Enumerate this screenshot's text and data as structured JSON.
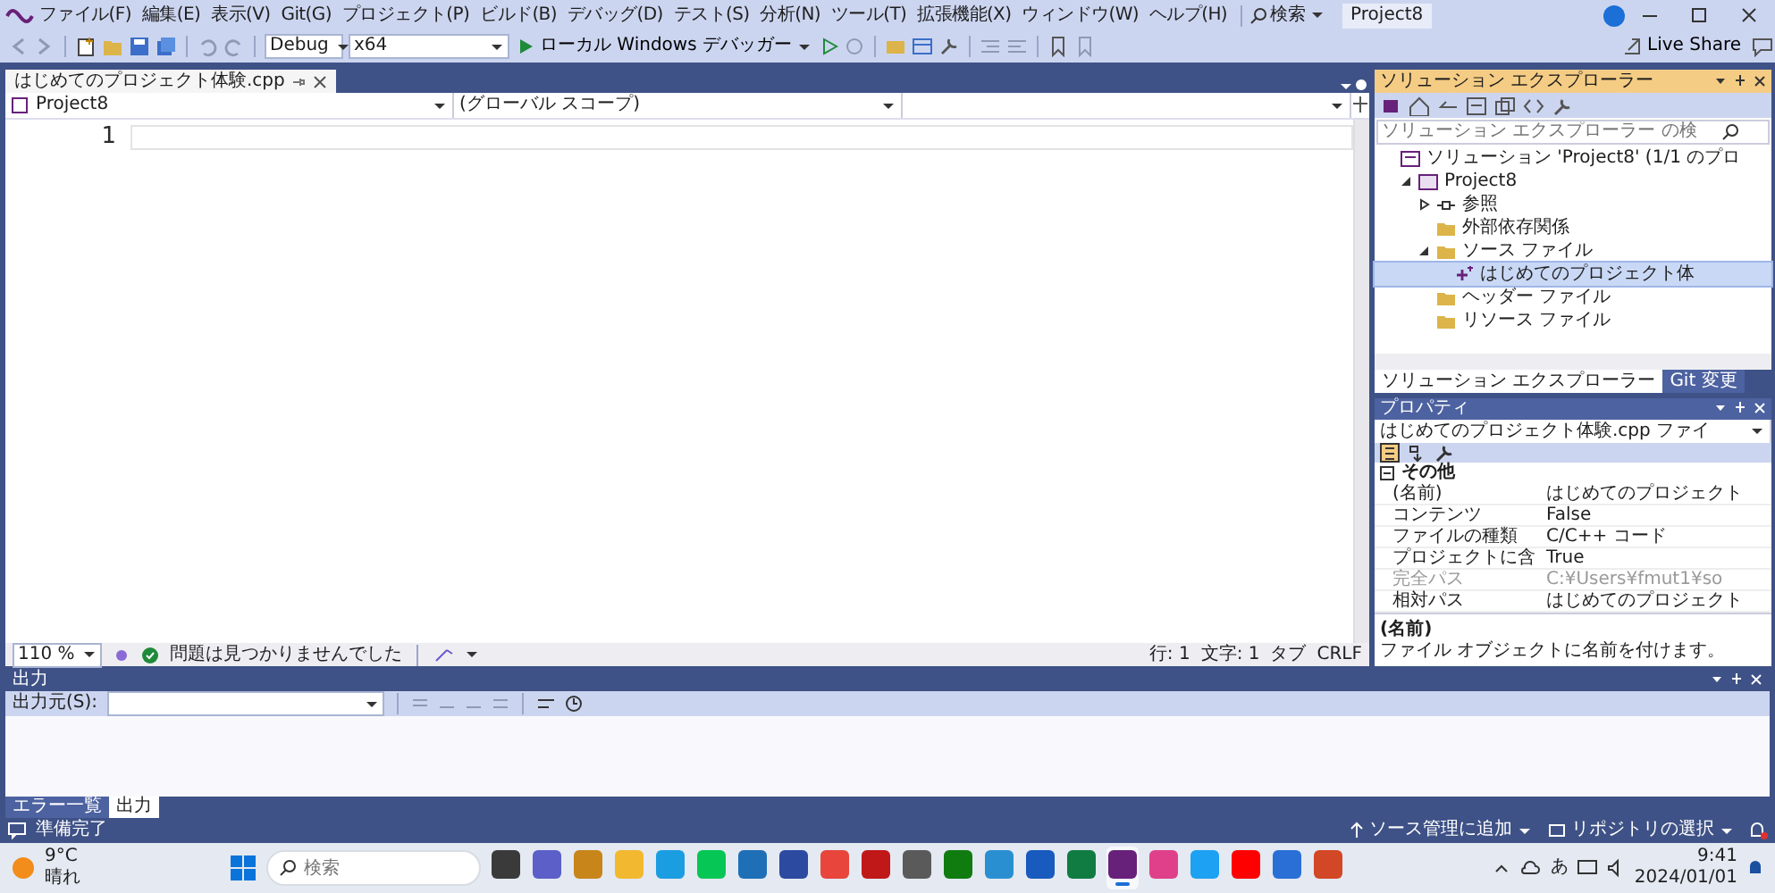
{
  "menu_bar": {
    "items": [
      "ファイル(F)",
      "編集(E)",
      "表示(V)",
      "Git(G)",
      "プロジェクト(P)",
      "ビルド(B)",
      "デバッグ(D)",
      "テスト(S)",
      "分析(N)",
      "ツール(T)",
      "拡張機能(X)",
      "ウィンドウ(W)",
      "ヘルプ(H)"
    ],
    "search": "検索",
    "solution_name": "Project8"
  },
  "toolbar": {
    "configuration": "Debug",
    "platform": "x64",
    "start_button": "ローカル Windows デバッガー",
    "live_share": "Live Share"
  },
  "document_tabs": [
    {
      "label": "はじめてのプロジェクト体験.cpp",
      "selected": true
    }
  ],
  "navigation_bar": {
    "project": "Project8",
    "scope": "(グローバル スコープ)"
  },
  "editor": {
    "line_numbers": [
      "1"
    ]
  },
  "editor_status": {
    "zoom": "110 %",
    "issues": "問題は見つかりませんでした",
    "line": "行: 1",
    "column": "文字: 1",
    "indent": "タブ",
    "line_ending": "CRLF"
  },
  "solution_explorer": {
    "title": "ソリューション エクスプローラー",
    "placeholder": "ソリューション エクスプローラー の検",
    "tree": [
      {
        "kind": "solution",
        "label": "ソリューション 'Project8' (1/1 のプロ",
        "selected": false,
        "children": [
          {
            "kind": "project",
            "label": "Project8",
            "expanded": true,
            "selected": false,
            "children": [
              {
                "kind": "references",
                "label": "参照",
                "expanded": false,
                "selected": false
              },
              {
                "kind": "folder",
                "label": "外部依存関係",
                "selected": false
              },
              {
                "kind": "folder",
                "label": "ソース ファイル",
                "expanded": true,
                "selected": false,
                "children": [
                  {
                    "kind": "file",
                    "label": "はじめてのプロジェクト体",
                    "selected": true
                  }
                ]
              },
              {
                "kind": "folder",
                "label": "ヘッダー ファイル",
                "selected": false
              },
              {
                "kind": "folder",
                "label": "リソース ファイル",
                "selected": false
              }
            ]
          }
        ]
      }
    ],
    "tabs": [
      {
        "label": "ソリューション エクスプローラー",
        "selected": true
      },
      {
        "label": "Git 変更",
        "selected": false
      }
    ]
  },
  "properties": {
    "title": "プロパティ",
    "object": "はじめてのプロジェクト体験.cpp  ファイ",
    "category": "その他",
    "rows": [
      {
        "name": "(名前)",
        "value": "はじめてのプロジェクト",
        "disabled": false
      },
      {
        "name": "コンテンツ",
        "value": "False",
        "disabled": false
      },
      {
        "name": "ファイルの種類",
        "value": "C/C++ コード",
        "disabled": false
      },
      {
        "name": "プロジェクトに含",
        "value": "True",
        "disabled": false
      },
      {
        "name": "完全パス",
        "value": "C:¥Users¥fmut1¥so",
        "disabled": true
      },
      {
        "name": "相対パス",
        "value": "はじめてのプロジェクト",
        "disabled": false
      }
    ],
    "description_title": "(名前)",
    "description": "ファイル オブジェクトに名前を付けます。"
  },
  "output": {
    "title": "出力",
    "source_label": "出力元(S):",
    "tabs": [
      {
        "label": "エラー一覧",
        "selected": false
      },
      {
        "label": "出力",
        "selected": true
      }
    ]
  },
  "status_bar": {
    "message": "準備完了",
    "add_to_source_control": "ソース管理に追加",
    "select_repository": "リポジトリの選択"
  },
  "taskbar": {
    "temperature": "9°C",
    "weather": "晴れ",
    "placeholder": "検索",
    "ime": "あ",
    "time": "9:41",
    "date": "2024/01/01",
    "apps": [
      {
        "color": "#3a3a3a",
        "selected": false
      },
      {
        "color": "#5b5fc7",
        "selected": false
      },
      {
        "color": "#c7851a",
        "selected": false
      },
      {
        "color": "#f2b930",
        "selected": false
      },
      {
        "color": "#1b9de2",
        "selected": false
      },
      {
        "color": "#06c755",
        "selected": false
      },
      {
        "color": "#1f6fb7",
        "selected": false
      },
      {
        "color": "#2b4aa0",
        "selected": false
      },
      {
        "color": "#e8453c",
        "selected": false
      },
      {
        "color": "#c01818",
        "selected": false
      },
      {
        "color": "#5a5a5a",
        "selected": false
      },
      {
        "color": "#107c10",
        "selected": false
      },
      {
        "color": "#2a8fd0",
        "selected": false
      },
      {
        "color": "#185abd",
        "selected": false
      },
      {
        "color": "#107c41",
        "selected": false
      },
      {
        "color": "#68217a",
        "selected": true
      },
      {
        "color": "#e0408a",
        "selected": false
      },
      {
        "color": "#1da1f2",
        "selected": false
      },
      {
        "color": "#ff0000",
        "selected": false
      },
      {
        "color": "#2a6fd6",
        "selected": false
      },
      {
        "color": "#d24726",
        "selected": false
      }
    ]
  }
}
